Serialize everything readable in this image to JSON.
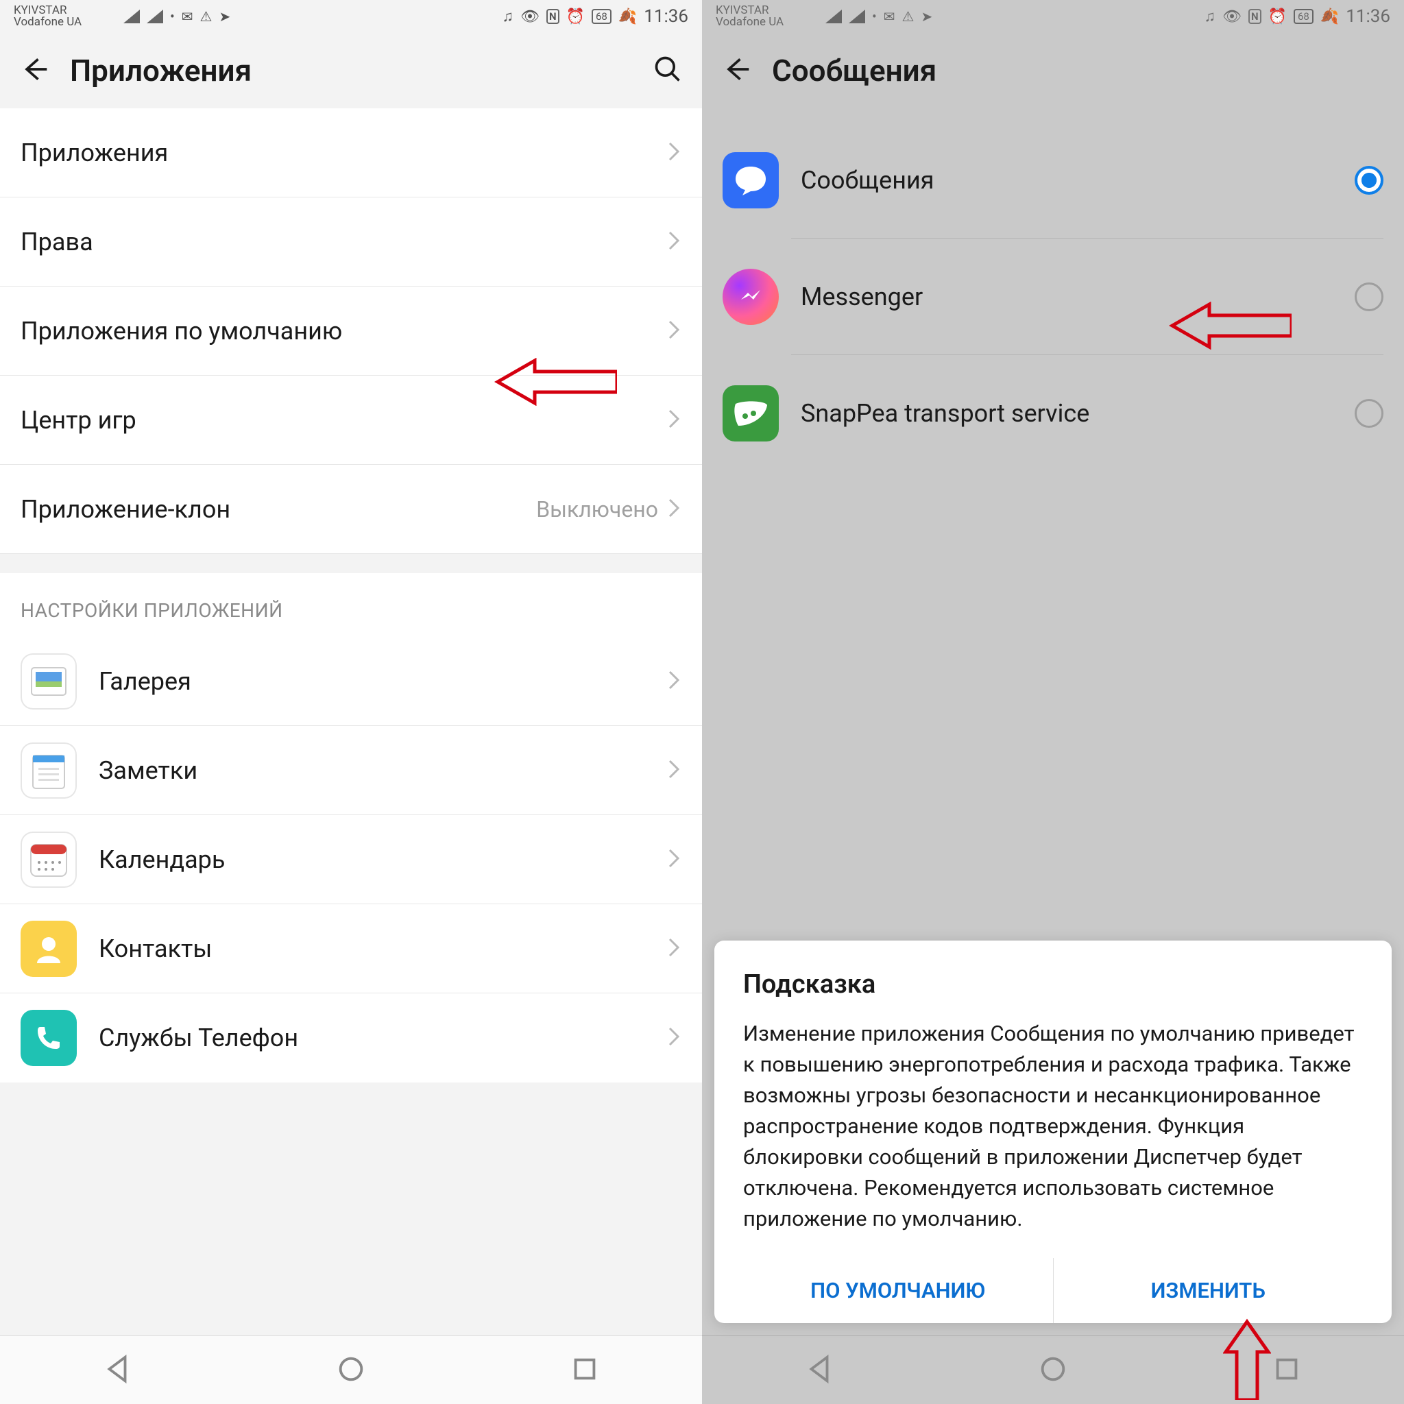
{
  "status": {
    "carrier1": "KYIVSTAR",
    "carrier2": "Vodafone UA",
    "battery": "68",
    "time": "11:36"
  },
  "left": {
    "title": "Приложения",
    "rows": {
      "apps": "Приложения",
      "perms": "Права",
      "defaults": "Приложения по умолчанию",
      "gamecenter": "Центр игр",
      "clone": "Приложение-клон",
      "clone_val": "Выключено"
    },
    "section": "НАСТРОЙКИ ПРИЛОЖЕНИЙ",
    "apps": {
      "gallery": "Галерея",
      "notes": "Заметки",
      "calendar": "Календарь",
      "contacts": "Контакты",
      "phone": "Службы Телефон"
    }
  },
  "right": {
    "title": "Сообщения",
    "options": {
      "messages": "Сообщения",
      "messenger": "Messenger",
      "snappea": "SnapPea transport service"
    },
    "dialog": {
      "title": "Подсказка",
      "body": "Изменение приложения Сообщения по умолчанию приведет к повышению энергопотребления и расхода трафика. Также возможны угрозы безопасности и несанкционированное распространение кодов подтверждения. Функция блокировки сообщений в приложении Диспетчер будет отключена. Рекомендуется использовать системное приложение по умолчанию.",
      "default_btn": "ПО УМОЛЧАНИЮ",
      "change_btn": "ИЗМЕНИТЬ"
    }
  }
}
